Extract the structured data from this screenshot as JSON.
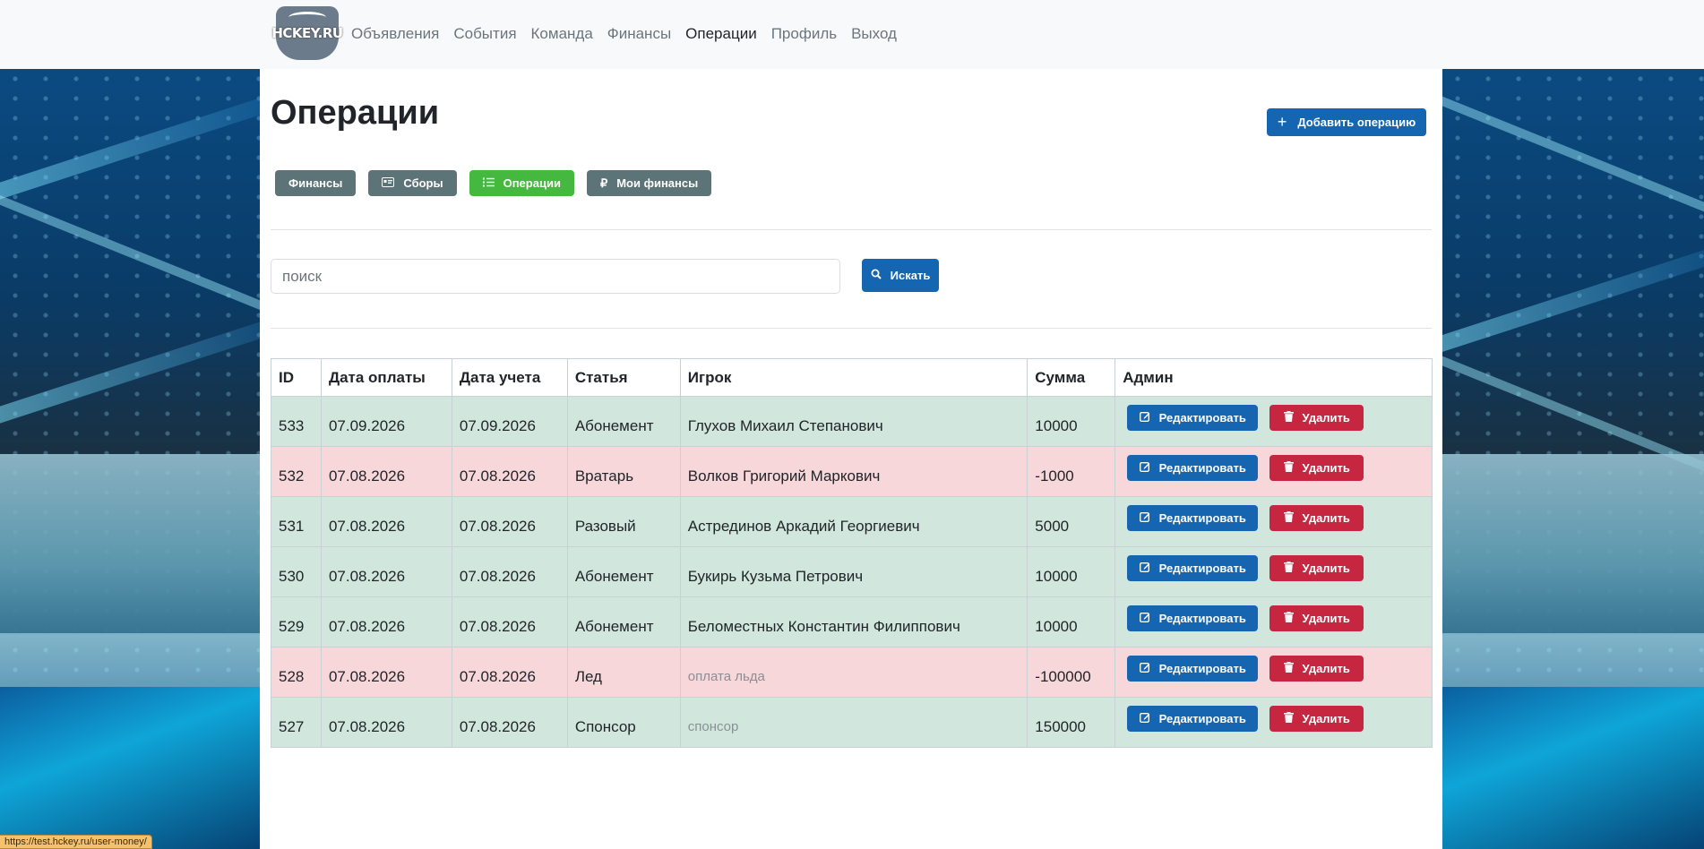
{
  "nav": {
    "logo_text": "HCKEY.RU",
    "links": [
      "Объявления",
      "События",
      "Команда",
      "Финансы",
      "Операции",
      "Профиль",
      "Выход"
    ],
    "active": "Операции"
  },
  "page": {
    "title": "Операции",
    "add_button": "Добавить операцию"
  },
  "sub_nav": {
    "finance": "Финансы",
    "fees": "Сборы",
    "operations": "Операции",
    "my_finance": "Мои финансы"
  },
  "search": {
    "placeholder": "поиск",
    "button": "Искать"
  },
  "table": {
    "headers": [
      "ID",
      "Дата оплаты",
      "Дата учета",
      "Статья",
      "Игрок",
      "Сумма",
      "Админ"
    ],
    "edit_label": "Редактировать",
    "delete_label": "Удалить",
    "rows": [
      {
        "id": "533",
        "pay_date": "07.09.2026",
        "acc_date": "07.09.2026",
        "article": "Абонемент",
        "player": "Глухов Михаил Степанович",
        "amount": "10000",
        "type": "pos"
      },
      {
        "id": "532",
        "pay_date": "07.08.2026",
        "acc_date": "07.08.2026",
        "article": "Вратарь",
        "player": "Волков Григорий Маркович",
        "amount": "-1000",
        "type": "neg"
      },
      {
        "id": "531",
        "pay_date": "07.08.2026",
        "acc_date": "07.08.2026",
        "article": "Разовый",
        "player": "Астрединов Аркадий Георгиевич",
        "amount": "5000",
        "type": "pos"
      },
      {
        "id": "530",
        "pay_date": "07.08.2026",
        "acc_date": "07.08.2026",
        "article": "Абонемент",
        "player": "Букирь Кузьма Петрович",
        "amount": "10000",
        "type": "pos"
      },
      {
        "id": "529",
        "pay_date": "07.08.2026",
        "acc_date": "07.08.2026",
        "article": "Абонемент",
        "player": "Беломестных Константин Филиппович",
        "amount": "10000",
        "type": "pos"
      },
      {
        "id": "528",
        "pay_date": "07.08.2026",
        "acc_date": "07.08.2026",
        "article": "Лед",
        "player": "оплата льда",
        "amount": "-100000",
        "type": "neg",
        "player_muted": true
      },
      {
        "id": "527",
        "pay_date": "07.08.2026",
        "acc_date": "07.08.2026",
        "article": "Спонсор",
        "player": "спонсор",
        "amount": "150000",
        "type": "pos",
        "player_muted": true
      }
    ]
  },
  "status_bar": {
    "url": "https://test.hckey.ru/user-money/"
  },
  "colors": {
    "primary": "#1565b0",
    "success": "#45b840",
    "secondary": "#5c7377",
    "danger": "#c72640",
    "row_positive": "#d1e7dd",
    "row_negative": "#f8d7da"
  }
}
